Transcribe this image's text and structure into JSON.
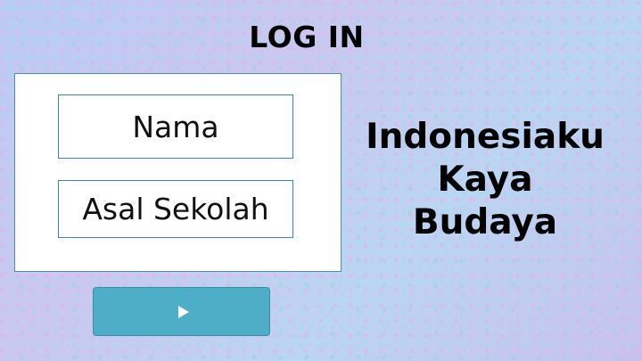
{
  "header": {
    "title": "LOG IN"
  },
  "form": {
    "name_field": {
      "placeholder": "Nama"
    },
    "school_field": {
      "placeholder": "Asal Sekolah"
    },
    "submit_button": {
      "icon": "play-icon"
    }
  },
  "tagline": {
    "lines": [
      "Indonesiaku",
      "Kaya",
      "Budaya"
    ]
  },
  "colors": {
    "button": "#4eaec8",
    "field_border": "#3c88ad",
    "card_background": "#ffffff",
    "page_background": "#bcd0f2"
  }
}
